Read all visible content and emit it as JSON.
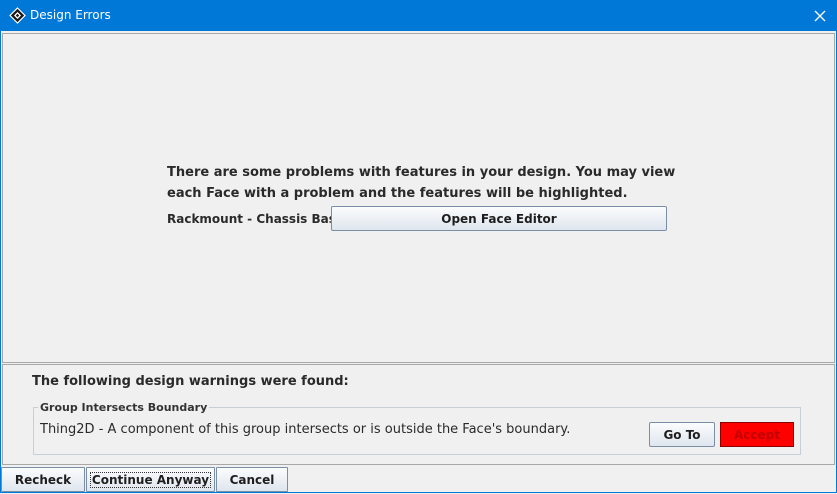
{
  "window": {
    "title": "Design Errors",
    "app_icon": "app-diamond-icon",
    "close_icon": "close-icon",
    "accent_color": "#0078d7"
  },
  "errors": {
    "message_line1": "There are some problems with features in your design. You may view",
    "message_line2": "each Face with a problem and the features will be highlighted.",
    "face_name": "Rackmount - Chassis Base",
    "open_face_editor_label": "Open Face Editor"
  },
  "warnings": {
    "heading": "The following design warnings were found:",
    "groups": [
      {
        "title": "Group Intersects Boundary",
        "description": "Thing2D - A component of this group intersects or is outside the Face's boundary.",
        "goto_label": "Go To",
        "accept_label": "Accept",
        "accept_color": "#ff0000"
      }
    ]
  },
  "footer": {
    "recheck_label": "Recheck",
    "continue_label": "Continue Anyway",
    "cancel_label": "Cancel"
  }
}
